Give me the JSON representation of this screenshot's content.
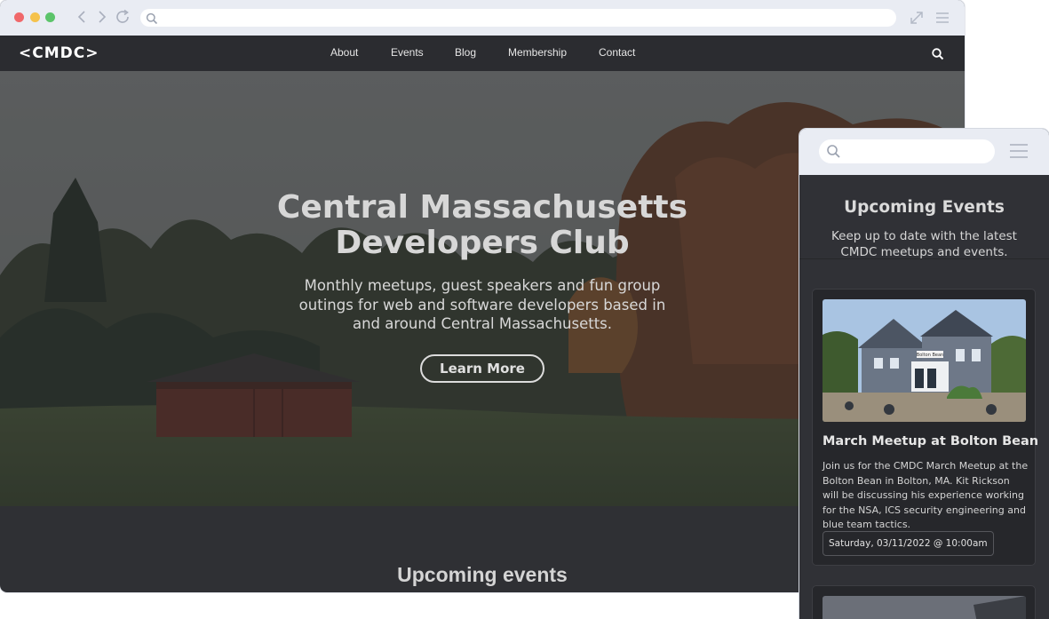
{
  "desktop": {
    "site": {
      "logo": "<CMDC>",
      "nav": [
        "About",
        "Events",
        "Blog",
        "Membership",
        "Contact"
      ]
    },
    "hero": {
      "title": "Central Massachusetts Developers Club",
      "subtitle": "Monthly meetups, guest speakers and fun group outings for web and software developers based in and around Central Massachusetts.",
      "cta_label": "Learn More"
    },
    "events_heading": "Upcoming events"
  },
  "mobile": {
    "heading": "Upcoming Events",
    "subheading": "Keep up to date with the latest CMDC meetups and events.",
    "events": [
      {
        "title": "March Meetup at Bolton Bean",
        "description": "Join us for the CMDC March Meetup at the Bolton Bean in Bolton, MA. Kit Rickson will be discussing his experience working for the NSA, ICS security engineering and blue team tactics.",
        "date": "Saturday, 03/11/2022 @ 10:00am",
        "sign_text": "Bolton Bean"
      }
    ]
  },
  "icons": {
    "back": "chevron-left-icon",
    "forward": "chevron-right-icon",
    "reload": "reload-icon",
    "search": "search-icon",
    "expand": "expand-icon",
    "menu": "hamburger-menu-icon"
  },
  "colors": {
    "chrome": "#e9ecf3",
    "nav_bg": "#2b2c30",
    "page_bg": "#2f3034",
    "card_bg": "#26272b",
    "dot_red": "#f0686a",
    "dot_yellow": "#f5c24c",
    "dot_green": "#5cc46a"
  }
}
